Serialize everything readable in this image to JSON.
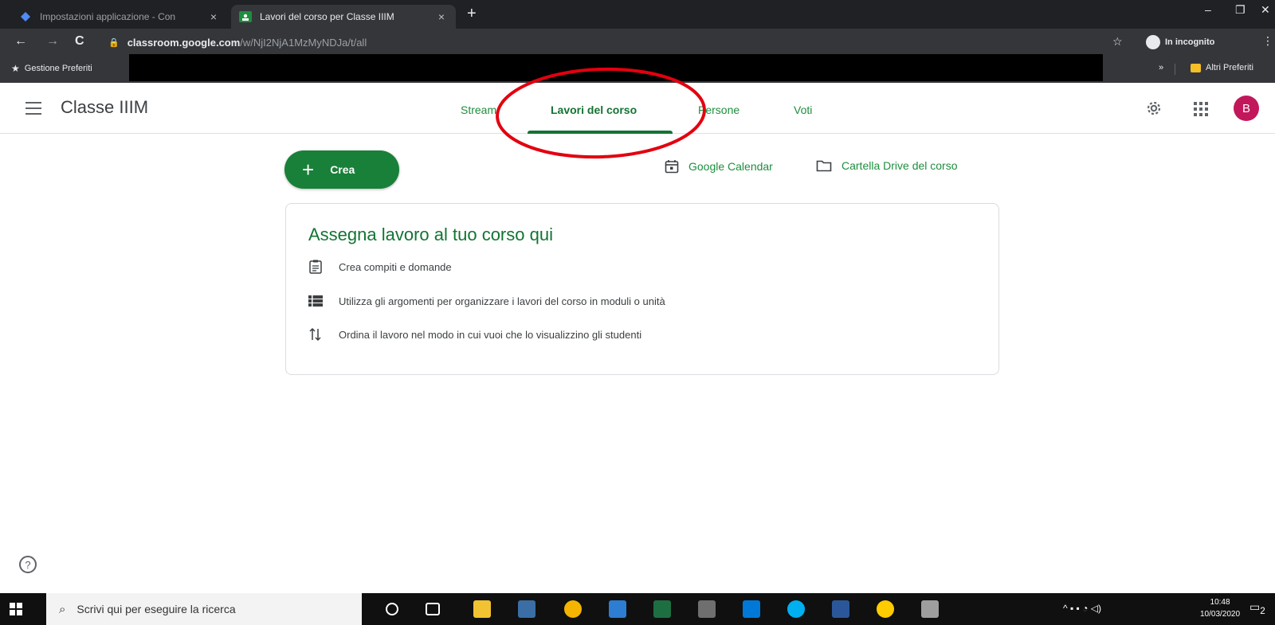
{
  "browser": {
    "tabs": [
      {
        "title": "Impostazioni applicazione - Con",
        "close": "×"
      },
      {
        "title": "Lavori del corso per Classe IIIM",
        "close": "×"
      }
    ],
    "new_tab": "+",
    "window_controls": {
      "minimize": "–",
      "restore": "❐",
      "close": "✕"
    },
    "nav": {
      "back": "←",
      "forward": "→",
      "reload": "C"
    },
    "url_host": "classroom.google.com",
    "url_path": "/w/NjI2NjA1MzMyNDJa/t/all",
    "incognito_label": "In incognito",
    "bookmarks": {
      "manager": "Gestione Preferiti",
      "overflow": "»",
      "other": "Altri Preferiti"
    }
  },
  "app": {
    "class_name": "Classe IIIM",
    "tabs": [
      {
        "label": "Stream"
      },
      {
        "label": "Lavori del corso",
        "active": true
      },
      {
        "label": "Persone"
      },
      {
        "label": "Voti"
      }
    ],
    "avatar_initial": "B",
    "create_button": "Crea",
    "calendar_link": "Google Calendar",
    "drive_link": "Cartella Drive del corso",
    "empty_state": {
      "title": "Assegna lavoro al tuo corso qui",
      "items": [
        {
          "icon": "assignment-icon",
          "text": "Crea compiti e domande"
        },
        {
          "icon": "topic-list-icon",
          "text": "Utilizza gli argomenti per organizzare i lavori del corso in moduli o unità"
        },
        {
          "icon": "reorder-icon",
          "text": "Ordina il lavoro nel modo in cui vuoi che lo visualizzino gli studenti"
        }
      ]
    },
    "help": "?"
  },
  "taskbar": {
    "search_placeholder": "Scrivi qui per eseguire la ricerca",
    "time": "10:48",
    "date": "10/03/2020",
    "notifications": "2"
  },
  "colors": {
    "accent_green": "#137333",
    "button_green": "#188038",
    "annotation_red": "#e3000f",
    "avatar_pink": "#c2185b"
  }
}
